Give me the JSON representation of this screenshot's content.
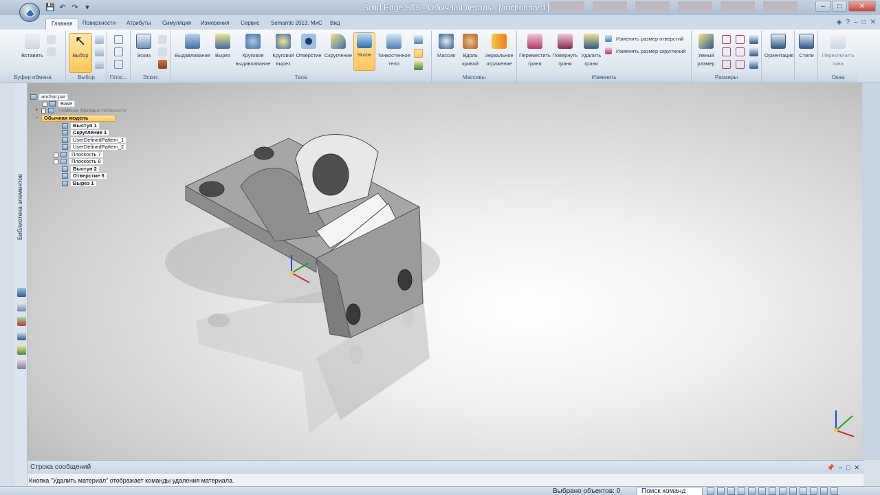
{
  "titlebar": {
    "title": "Solid Edge ST5 - Обычная деталь - [anchor.par:1]"
  },
  "tabs": [
    "Главная",
    "Поверхности",
    "Атрибуты",
    "Симуляция",
    "Измерения",
    "Сервис",
    "Semantic 2013. МиС",
    "Вид"
  ],
  "ribbon": {
    "clipboard": {
      "paste": "Вставить",
      "label": "Буфер обмена"
    },
    "select": {
      "button": "Выбор",
      "label": "Выбор"
    },
    "planes": {
      "label": "Плос..."
    },
    "sketch": {
      "button": "Эскиз",
      "label": "Эскиз"
    },
    "bodies": {
      "label": "Тела",
      "extrude": "Выдавливание",
      "cut": "Вырез",
      "revolve_1": "Круговое",
      "revolve_2": "выдавливание",
      "revcut_1": "Круговой",
      "revcut_2": "вырез",
      "hole": "Отверстие",
      "round": "Скругление",
      "draft": "Уклон",
      "thin_1": "Тонкостенное",
      "thin_2": "тело"
    },
    "patterns": {
      "label": "Массивы",
      "pattern": "Массив",
      "along_1": "Вдоль",
      "along_2": "кривой",
      "mirror_1": "Зеркальное",
      "mirror_2": "отражение"
    },
    "modify": {
      "label": "Изменить",
      "move_1": "Переместить",
      "move_2": "грани",
      "rotate_1": "Повернуть",
      "rotate_2": "грани",
      "delete_1": "Удалить",
      "delete_2": "грани",
      "resize_holes": "Изменить размер отверстий",
      "resize_rounds": "Изменить размер скруглений"
    },
    "dimensions": {
      "label": "Размеры",
      "smart_1": "Умный",
      "smart_2": "размер"
    },
    "orient": {
      "button": "Ориентация"
    },
    "styles": {
      "button": "Стили"
    },
    "window": {
      "label": "Окна",
      "switch_1": "Переключить",
      "switch_2": "окна"
    }
  },
  "sidebar": {
    "library": "Библиотека элементов"
  },
  "tree": {
    "root": "anchor.par",
    "base": "Base",
    "planes": "Главные базовые плоскости",
    "model": "Обычная модель",
    "features": [
      "Выступ 1",
      "Скругление 1",
      "UserDefinedPattern_1",
      "UserDefinedPattern_2",
      "Плоскость 7",
      "Плоскость 8",
      "Выступ 2",
      "Отверстие 5",
      "Вырез 1"
    ]
  },
  "messages": {
    "title": "Строка сообщений",
    "text": "Кнопка \"Удалить материал\" отображает команды удаления материала."
  },
  "status": {
    "selected": "Выбрано объектов: 0",
    "search": "Поиск команд"
  }
}
